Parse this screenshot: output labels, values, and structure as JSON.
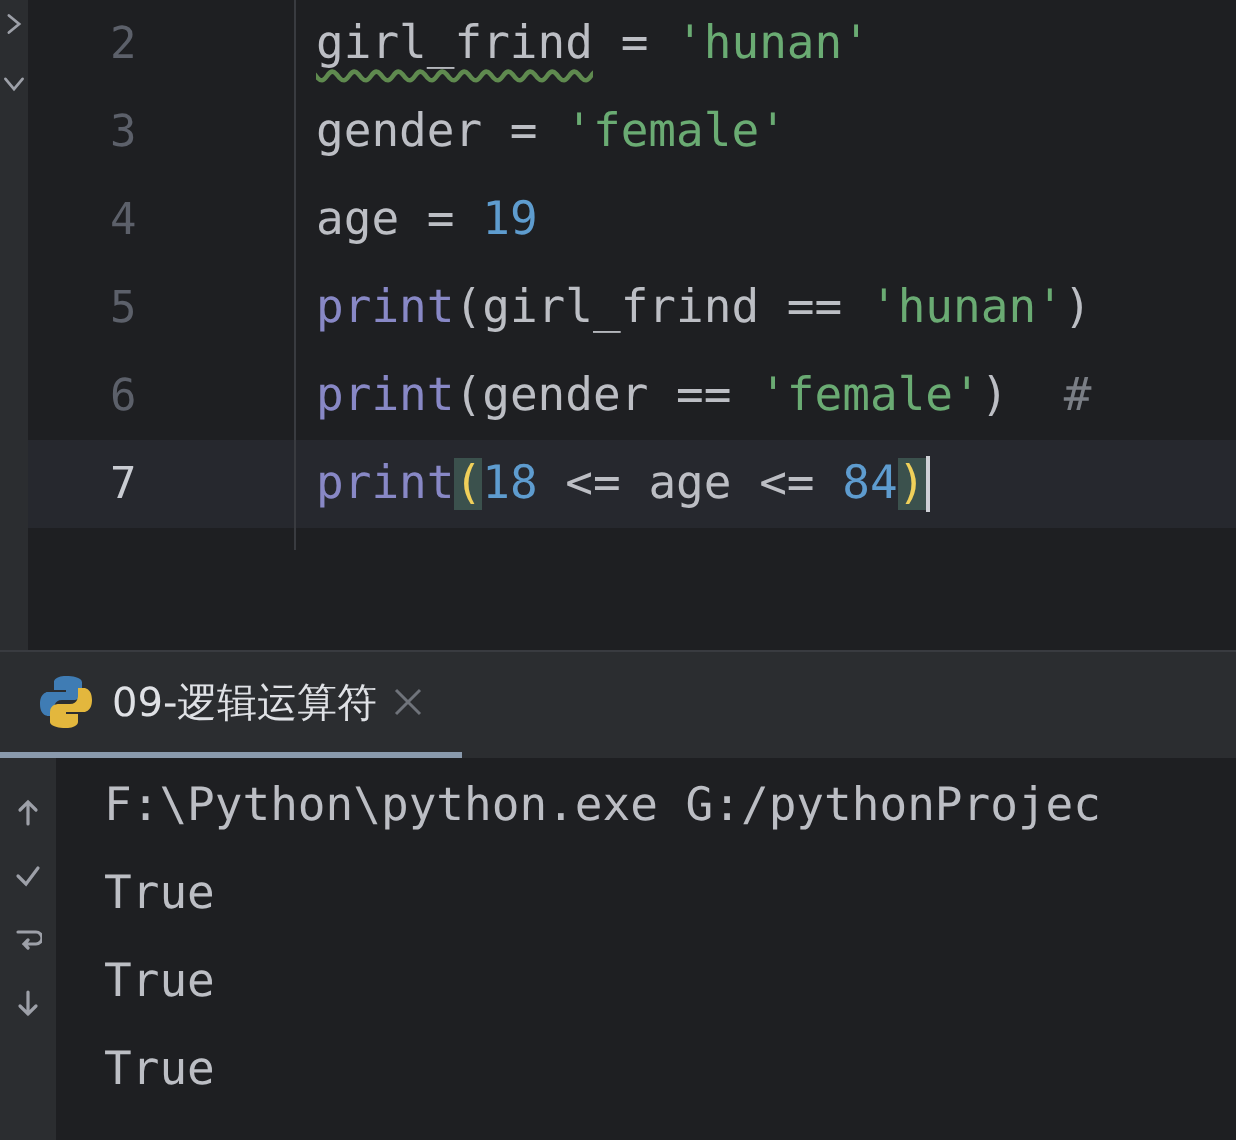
{
  "editor": {
    "lines": [
      {
        "number": "2",
        "current": false,
        "tokens": [
          {
            "kind": "typo",
            "text": "girl_frind"
          },
          {
            "kind": "plain",
            "text": " = "
          },
          {
            "kind": "string",
            "text": "'hunan'"
          }
        ]
      },
      {
        "number": "3",
        "current": false,
        "tokens": [
          {
            "kind": "plain",
            "text": "gender = "
          },
          {
            "kind": "string",
            "text": "'female'"
          }
        ]
      },
      {
        "number": "4",
        "current": false,
        "tokens": [
          {
            "kind": "plain",
            "text": "age = "
          },
          {
            "kind": "number",
            "text": "19"
          }
        ]
      },
      {
        "number": "5",
        "current": false,
        "tokens": [
          {
            "kind": "builtin",
            "text": "print"
          },
          {
            "kind": "plain",
            "text": "(girl_frind == "
          },
          {
            "kind": "string",
            "text": "'hunan'"
          },
          {
            "kind": "plain",
            "text": ")"
          }
        ]
      },
      {
        "number": "6",
        "current": false,
        "tokens": [
          {
            "kind": "builtin",
            "text": "print"
          },
          {
            "kind": "plain",
            "text": "(gender == "
          },
          {
            "kind": "string",
            "text": "'female'"
          },
          {
            "kind": "plain",
            "text": ")  "
          },
          {
            "kind": "comment",
            "text": "#"
          }
        ]
      },
      {
        "number": "7",
        "current": true,
        "tokens": [
          {
            "kind": "builtin",
            "text": "print"
          },
          {
            "kind": "match",
            "text": "("
          },
          {
            "kind": "number",
            "text": "18"
          },
          {
            "kind": "plain",
            "text": " <= age <= "
          },
          {
            "kind": "number",
            "text": "84"
          },
          {
            "kind": "match",
            "text": ")"
          }
        ]
      }
    ]
  },
  "run_panel": {
    "tabs": [
      {
        "label": "09-逻辑运算符",
        "selected": true
      }
    ],
    "output": [
      "F:\\Python\\python.exe G:/pythonProjec",
      "True",
      "True",
      "True"
    ]
  }
}
